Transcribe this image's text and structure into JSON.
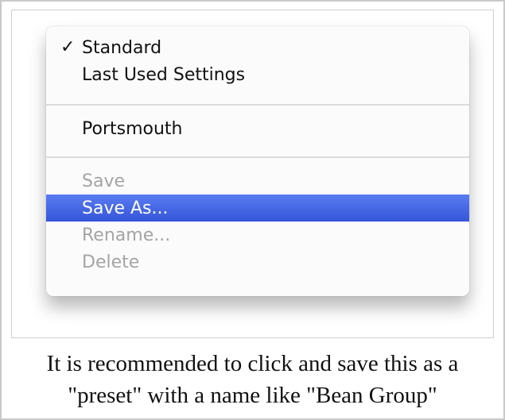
{
  "menu": {
    "items": [
      {
        "label": "Standard",
        "checked": true,
        "state": "normal"
      },
      {
        "label": "Last Used Settings",
        "state": "normal"
      },
      {
        "label": "Portsmouth",
        "state": "normal"
      },
      {
        "label": "Save",
        "state": "disabled"
      },
      {
        "label": "Save As...",
        "state": "highlighted"
      },
      {
        "label": "Rename...",
        "state": "disabled"
      },
      {
        "label": "Delete",
        "state": "disabled"
      }
    ],
    "checkmark": "✓",
    "highlight_color": "#3f63dd"
  },
  "caption": {
    "line1": "It is recommended to click and save this as a",
    "line2": "\"preset\" with a name like \"Bean Group\""
  }
}
